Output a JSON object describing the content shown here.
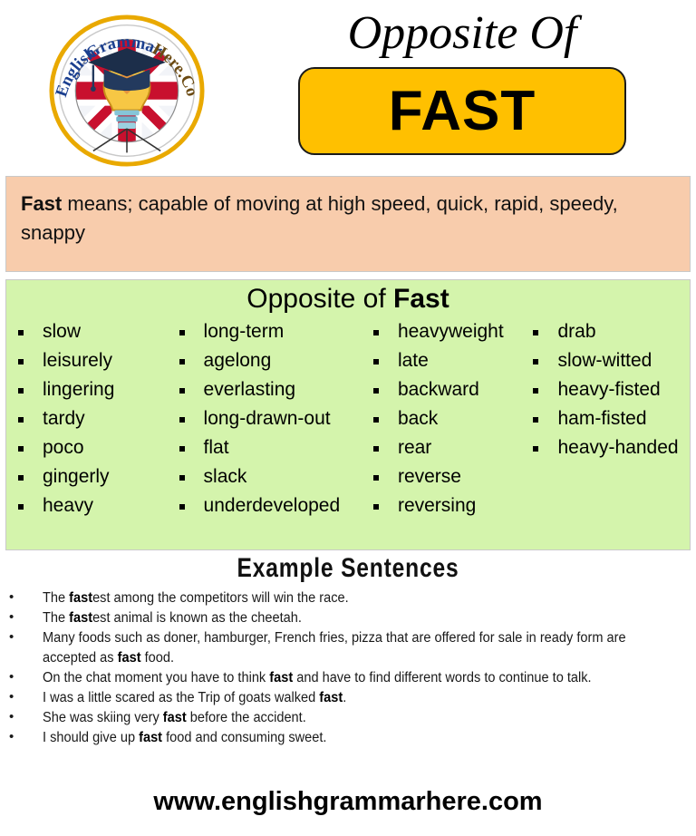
{
  "header": {
    "logo": {
      "alt": "English Grammar Here .Com logo",
      "arc_text_1": "English Grammar",
      "arc_text_2": "Here.Com",
      "ring_color": "#F2B705"
    },
    "title": "Opposite Of",
    "word": "FAST",
    "badge_color": "#FFC000"
  },
  "definition": {
    "term": "Fast",
    "rest": " means; capable of moving at high speed, quick, rapid, speedy, snappy",
    "background": "#F8CCAC"
  },
  "opposites": {
    "title_prefix": "Opposite of ",
    "title_term": "Fast",
    "background": "#D4F4AC",
    "columns": [
      [
        "slow",
        "leisurely",
        "lingering",
        "tardy",
        "poco",
        "gingerly",
        "heavy"
      ],
      [
        "long-term",
        "agelong",
        "everlasting",
        "long-drawn-out",
        "flat",
        "slack",
        "underdeveloped"
      ],
      [
        "heavyweight",
        "late",
        "backward",
        "back",
        "rear",
        "reverse",
        "reversing"
      ],
      [
        "drab",
        "slow-witted",
        "heavy-fisted",
        "ham-fisted",
        "heavy-handed"
      ]
    ]
  },
  "examples": {
    "title": "Example  Sentences",
    "items": [
      {
        "pre": "The ",
        "bold": "fast",
        "post": "est among the competitors will win the race."
      },
      {
        "pre": "The ",
        "bold": "fast",
        "post": "est animal is known as the cheetah."
      },
      {
        "pre": "Many foods such as doner, hamburger, French fries, pizza that are offered for sale in ready form are accepted as ",
        "bold": "fast",
        "post": " food."
      },
      {
        "pre": "On the chat moment you have to think ",
        "bold": "fast",
        "post": " and have to find different words to continue to talk."
      },
      {
        "pre": "I was a little scared as the Trip of goats walked ",
        "bold": "fast",
        "post": "."
      },
      {
        "pre": "She was skiing very ",
        "bold": "fast",
        "post": " before the accident."
      },
      {
        "pre": "I should give up ",
        "bold": "fast",
        "post": " food and consuming sweet."
      }
    ]
  },
  "footer": {
    "url": "www.englishgrammarhere.com"
  }
}
